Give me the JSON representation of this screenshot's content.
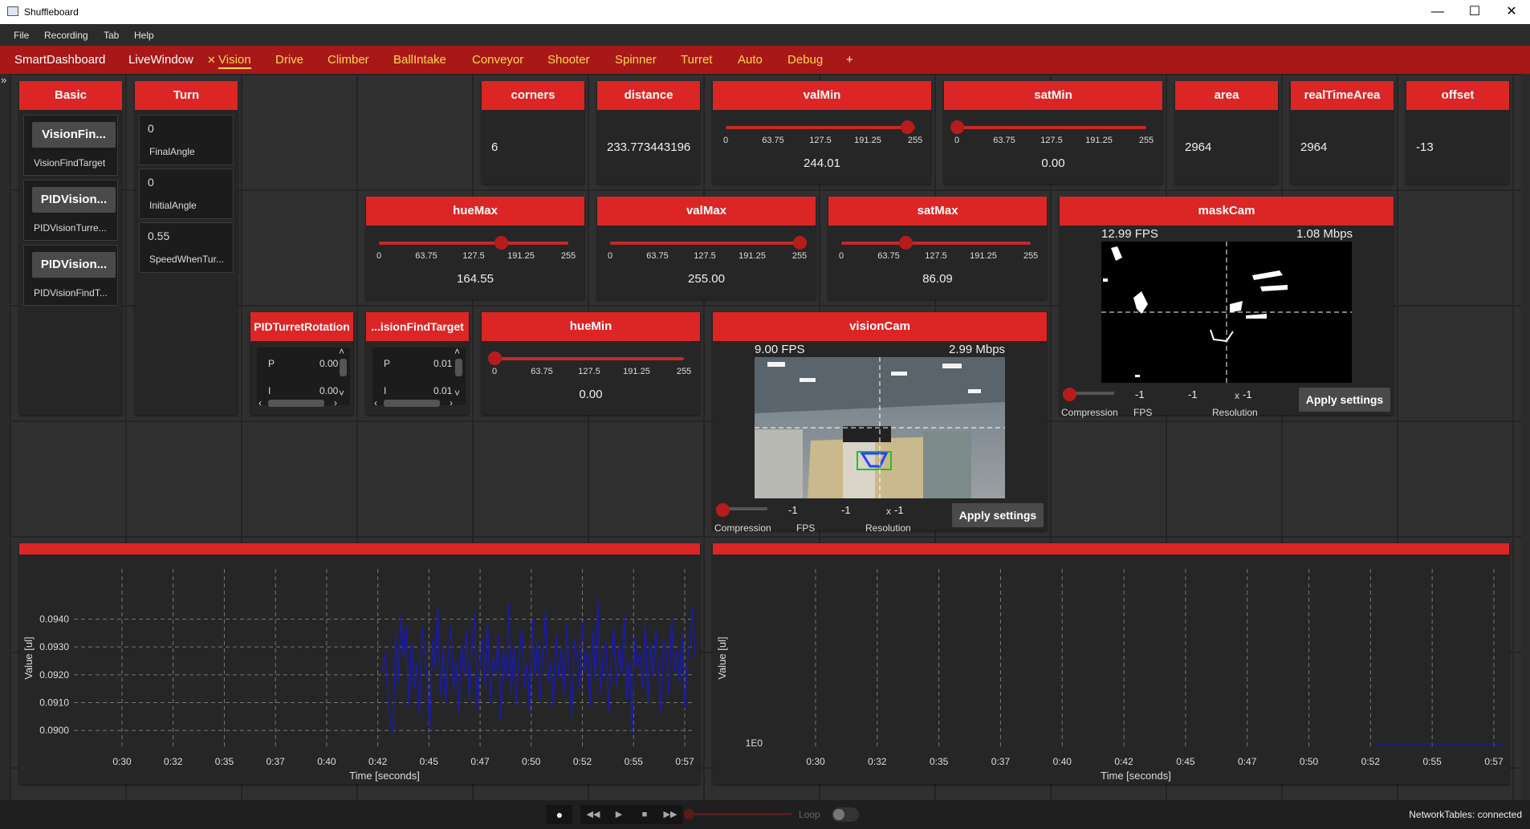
{
  "window": {
    "title": "Shuffleboard"
  },
  "menu": [
    "File",
    "Recording",
    "Tab",
    "Help"
  ],
  "tabs": [
    {
      "label": "SmartDashboard"
    },
    {
      "label": "LiveWindow"
    },
    {
      "label": "Vision",
      "close": "✕"
    },
    {
      "label": "Drive"
    },
    {
      "label": "Climber"
    },
    {
      "label": "BallIntake"
    },
    {
      "label": "Conveyor"
    },
    {
      "label": "Shooter"
    },
    {
      "label": "Spinner"
    },
    {
      "label": "Turret"
    },
    {
      "label": "Auto"
    },
    {
      "label": "Debug"
    },
    {
      "label": "+"
    }
  ],
  "basic": {
    "title": "Basic",
    "buttons": [
      {
        "label": "VisionFin...",
        "caption": "VisionFindTarget"
      },
      {
        "label": "PIDVision...",
        "caption": "PIDVisionTurre..."
      },
      {
        "label": "PIDVision...",
        "caption": "PIDVisionFindT..."
      }
    ]
  },
  "turn": {
    "title": "Turn",
    "entries": [
      {
        "value": "0",
        "label": "FinalAngle"
      },
      {
        "value": "0",
        "label": "InitialAngle"
      },
      {
        "value": "0.55",
        "label": "SpeedWhenTur..."
      }
    ]
  },
  "values": [
    {
      "title": "corners",
      "value": "6"
    },
    {
      "title": "distance",
      "value": "233.773443196"
    },
    {
      "title": "area",
      "value": "2964"
    },
    {
      "title": "realTimeArea",
      "value": "2964"
    },
    {
      "title": "offset",
      "value": "-13"
    }
  ],
  "slider_ticks": [
    "0",
    "63.75",
    "127.5",
    "191.25",
    "255"
  ],
  "sliders": [
    {
      "title": "valMin",
      "value": "244.01",
      "fraction": 0.957
    },
    {
      "title": "satMin",
      "value": "0.00",
      "fraction": 0.0
    },
    {
      "title": "hueMax",
      "value": "164.55",
      "fraction": 0.645
    },
    {
      "title": "valMax",
      "value": "255.00",
      "fraction": 1.0
    },
    {
      "title": "satMax",
      "value": "86.09",
      "fraction": 0.338
    },
    {
      "title": "hueMin",
      "value": "0.00",
      "fraction": 0.0
    }
  ],
  "pid": [
    {
      "title": "PIDTurretRotation",
      "p_label": "P",
      "p_value": "0.00",
      "i_label": "I",
      "i_value": "0.00"
    },
    {
      "title": "...isionFindTarget",
      "p_label": "P",
      "p_value": "0.01",
      "i_label": "I",
      "i_value": "0.01"
    }
  ],
  "cameras": {
    "mask": {
      "title": "maskCam",
      "fps": "12.99 FPS",
      "bandwidth": "1.08 Mbps",
      "fps_value": "-1",
      "res_w": "-1",
      "res_x": "x",
      "res_h": "-1",
      "compression_label": "Compression",
      "fps_label": "FPS",
      "res_label": "Resolution",
      "apply": "Apply settings"
    },
    "vision": {
      "title": "visionCam",
      "fps": "9.00 FPS",
      "bandwidth": "2.99 Mbps",
      "fps_value": "-1",
      "res_w": "-1",
      "res_x": "x",
      "res_h": "-1",
      "compression_label": "Compression",
      "fps_label": "FPS",
      "res_label": "Resolution",
      "apply": "Apply settings"
    }
  },
  "chart_data": [
    {
      "type": "line",
      "title": "",
      "xlabel": "Time [seconds]",
      "ylabel": "Value [ul]",
      "x_ticks": [
        "0:30",
        "0:32",
        "0:35",
        "0:37",
        "0:40",
        "0:42",
        "0:45",
        "0:47",
        "0:50",
        "0:52",
        "0:55",
        "0:57"
      ],
      "y_ticks": [
        "0.0940",
        "0.0930",
        "0.0920",
        "0.0910",
        "0.0900"
      ],
      "ylim": [
        0.0894,
        0.0958
      ],
      "grid": true,
      "series_color": "#1a1aa8",
      "series": [
        {
          "start_tick": "0:42",
          "values": [
            0.0921,
            0.0928,
            0.0912,
            0.0903,
            0.0899,
            0.0935,
            0.0917,
            0.0941,
            0.0926,
            0.0938,
            0.0908,
            0.0932,
            0.0915,
            0.0924,
            0.0905,
            0.0937,
            0.0929,
            0.0918,
            0.09,
            0.0933,
            0.0922,
            0.0945,
            0.0912,
            0.093,
            0.0909,
            0.0927,
            0.0938,
            0.0914,
            0.0925,
            0.0906,
            0.0931,
            0.092,
            0.0936,
            0.0911,
            0.0928,
            0.0942,
            0.0907,
            0.0923,
            0.0933,
            0.0916,
            0.0939,
            0.091,
            0.0926,
            0.0921,
            0.0934,
            0.0904,
            0.0929,
            0.0918,
            0.0946,
            0.0913,
            0.0931,
            0.0909,
            0.0927,
            0.0937,
            0.0915,
            0.0924,
            0.0906,
            0.094,
            0.092,
            0.0932,
            0.0911,
            0.0928,
            0.0943,
            0.0917,
            0.0925,
            0.0908,
            0.0935,
            0.0919,
            0.093,
            0.0912,
            0.0938,
            0.0922,
            0.0905,
            0.0933,
            0.0926,
            0.0914,
            0.0939,
            0.0921,
            0.0929,
            0.0909,
            0.0936,
            0.0918,
            0.0947,
            0.0913,
            0.0927,
            0.0932,
            0.0907,
            0.0924,
            0.0937,
            0.0916,
            0.093,
            0.092,
            0.0941,
            0.0911,
            0.0926,
            0.0899,
            0.0934,
            0.0923,
            0.0928,
            0.0915,
            0.0939,
            0.091,
            0.0931,
            0.0919,
            0.0936,
            0.0924,
            0.0906,
            0.0933,
            0.0928,
            0.0913,
            0.094,
            0.0921,
            0.0929,
            0.0917,
            0.0935,
            0.0908,
            0.0925,
            0.0931,
            0.0944,
            0.0926
          ]
        }
      ]
    },
    {
      "type": "line",
      "title": "",
      "xlabel": "Time [seconds]",
      "ylabel": "Value [ul]",
      "x_ticks": [
        "0:30",
        "0:32",
        "0:35",
        "0:37",
        "0:40",
        "0:42",
        "0:45",
        "0:47",
        "0:50",
        "0:52",
        "0:55",
        "0:57"
      ],
      "y_ticks": [
        "1E0"
      ],
      "grid": true,
      "series_color": "#1a1aa8",
      "series": [
        {
          "start_tick": "0:52",
          "values": [
            1,
            1,
            1,
            1,
            1,
            1
          ]
        }
      ]
    }
  ],
  "footer": {
    "loop_label": "Loop",
    "status": "NetworkTables: connected"
  }
}
